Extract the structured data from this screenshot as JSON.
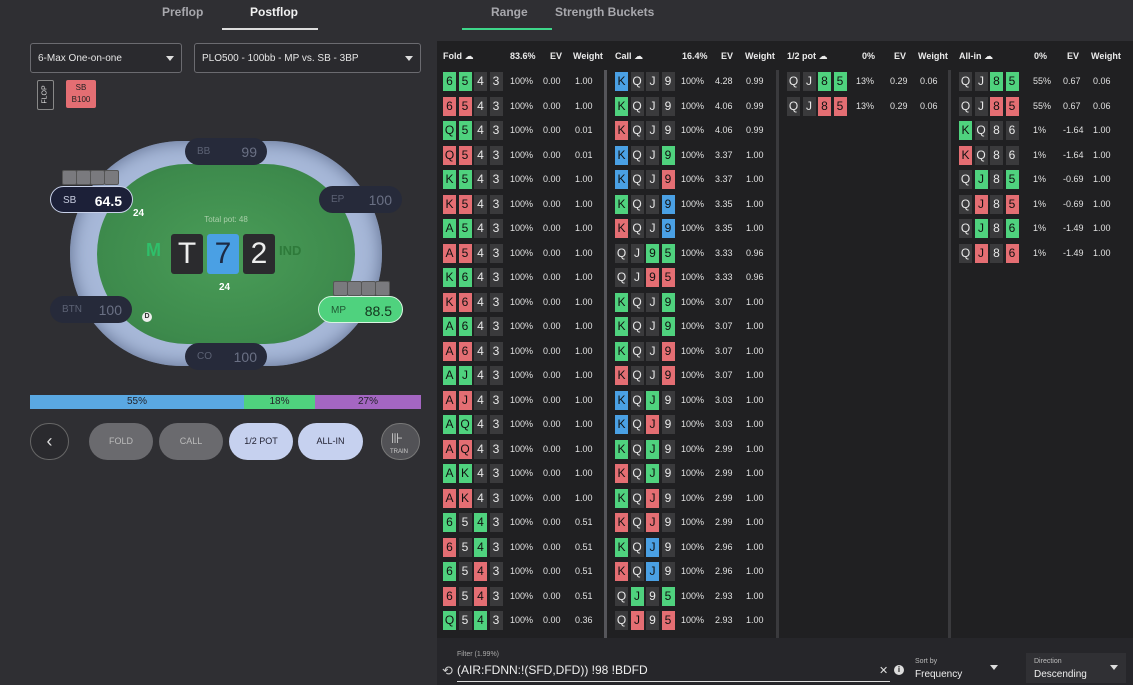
{
  "tabs": {
    "preflop": "Preflop",
    "postflop": "Postflop",
    "range": "Range",
    "buckets": "Strength Buckets"
  },
  "selects": {
    "game": "6-Max One-on-one",
    "spot": "PLO500 - 100bb - MP vs. SB - 3BP"
  },
  "chips": {
    "flop": "FLOP",
    "sb_line1": "SB",
    "sb_line2": "B100"
  },
  "table": {
    "total_pot": "Total pot: 48",
    "board": [
      "T",
      "7",
      "2"
    ],
    "brand": "IND",
    "seats": {
      "bb": {
        "name": "BB",
        "stack": "99"
      },
      "sb": {
        "name": "SB",
        "stack": "64.5",
        "bet": "24"
      },
      "ep": {
        "name": "EP",
        "stack": "100"
      },
      "btn": {
        "name": "BTN",
        "stack": "100"
      },
      "mp": {
        "name": "MP",
        "stack": "88.5",
        "bet": "24"
      },
      "co": {
        "name": "CO",
        "stack": "100"
      }
    },
    "dealer": "D"
  },
  "freq_bar": [
    {
      "label": "55%",
      "value": 55,
      "color": "#5aa8e2"
    },
    {
      "label": "18%",
      "value": 18,
      "color": "#4fd27e"
    },
    {
      "label": "27%",
      "value": 27,
      "color": "#a466c2"
    }
  ],
  "buttons": {
    "back": "‹",
    "fold": "FOLD",
    "call": "CALL",
    "half": "1/2 POT",
    "allin": "ALL-IN",
    "train": "TRAIN"
  },
  "headers": {
    "fold": {
      "title": "Fold",
      "pct": "83.6%",
      "ev": "EV",
      "w": "Weight"
    },
    "call": {
      "title": "Call",
      "pct": "16.4%",
      "ev": "EV",
      "w": "Weight"
    },
    "half": {
      "title": "1/2 pot",
      "pct": "0%",
      "ev": "EV",
      "w": "Weight"
    },
    "allin": {
      "title": "All-in",
      "pct": "0%",
      "ev": "EV",
      "w": "Weight"
    }
  },
  "fold_rows": [
    {
      "c": [
        [
          "6",
          "g"
        ],
        [
          "5",
          "g"
        ],
        [
          "4",
          "d"
        ],
        [
          "3",
          "d"
        ]
      ],
      "p": "100%",
      "e": "0.00",
      "w": "1.00"
    },
    {
      "c": [
        [
          "6",
          "r"
        ],
        [
          "5",
          "r"
        ],
        [
          "4",
          "d"
        ],
        [
          "3",
          "d"
        ]
      ],
      "p": "100%",
      "e": "0.00",
      "w": "1.00"
    },
    {
      "c": [
        [
          "Q",
          "g"
        ],
        [
          "5",
          "g"
        ],
        [
          "4",
          "d"
        ],
        [
          "3",
          "d"
        ]
      ],
      "p": "100%",
      "e": "0.00",
      "w": "0.01"
    },
    {
      "c": [
        [
          "Q",
          "r"
        ],
        [
          "5",
          "r"
        ],
        [
          "4",
          "d"
        ],
        [
          "3",
          "d"
        ]
      ],
      "p": "100%",
      "e": "0.00",
      "w": "0.01"
    },
    {
      "c": [
        [
          "K",
          "g"
        ],
        [
          "5",
          "g"
        ],
        [
          "4",
          "d"
        ],
        [
          "3",
          "d"
        ]
      ],
      "p": "100%",
      "e": "0.00",
      "w": "1.00"
    },
    {
      "c": [
        [
          "K",
          "r"
        ],
        [
          "5",
          "r"
        ],
        [
          "4",
          "d"
        ],
        [
          "3",
          "d"
        ]
      ],
      "p": "100%",
      "e": "0.00",
      "w": "1.00"
    },
    {
      "c": [
        [
          "A",
          "g"
        ],
        [
          "5",
          "g"
        ],
        [
          "4",
          "d"
        ],
        [
          "3",
          "d"
        ]
      ],
      "p": "100%",
      "e": "0.00",
      "w": "1.00"
    },
    {
      "c": [
        [
          "A",
          "r"
        ],
        [
          "5",
          "r"
        ],
        [
          "4",
          "d"
        ],
        [
          "3",
          "d"
        ]
      ],
      "p": "100%",
      "e": "0.00",
      "w": "1.00"
    },
    {
      "c": [
        [
          "K",
          "g"
        ],
        [
          "6",
          "g"
        ],
        [
          "4",
          "d"
        ],
        [
          "3",
          "d"
        ]
      ],
      "p": "100%",
      "e": "0.00",
      "w": "1.00"
    },
    {
      "c": [
        [
          "K",
          "r"
        ],
        [
          "6",
          "r"
        ],
        [
          "4",
          "d"
        ],
        [
          "3",
          "d"
        ]
      ],
      "p": "100%",
      "e": "0.00",
      "w": "1.00"
    },
    {
      "c": [
        [
          "A",
          "g"
        ],
        [
          "6",
          "g"
        ],
        [
          "4",
          "d"
        ],
        [
          "3",
          "d"
        ]
      ],
      "p": "100%",
      "e": "0.00",
      "w": "1.00"
    },
    {
      "c": [
        [
          "A",
          "r"
        ],
        [
          "6",
          "r"
        ],
        [
          "4",
          "d"
        ],
        [
          "3",
          "d"
        ]
      ],
      "p": "100%",
      "e": "0.00",
      "w": "1.00"
    },
    {
      "c": [
        [
          "A",
          "g"
        ],
        [
          "J",
          "g"
        ],
        [
          "4",
          "d"
        ],
        [
          "3",
          "d"
        ]
      ],
      "p": "100%",
      "e": "0.00",
      "w": "1.00"
    },
    {
      "c": [
        [
          "A",
          "r"
        ],
        [
          "J",
          "r"
        ],
        [
          "4",
          "d"
        ],
        [
          "3",
          "d"
        ]
      ],
      "p": "100%",
      "e": "0.00",
      "w": "1.00"
    },
    {
      "c": [
        [
          "A",
          "g"
        ],
        [
          "Q",
          "g"
        ],
        [
          "4",
          "d"
        ],
        [
          "3",
          "d"
        ]
      ],
      "p": "100%",
      "e": "0.00",
      "w": "1.00"
    },
    {
      "c": [
        [
          "A",
          "r"
        ],
        [
          "Q",
          "r"
        ],
        [
          "4",
          "d"
        ],
        [
          "3",
          "d"
        ]
      ],
      "p": "100%",
      "e": "0.00",
      "w": "1.00"
    },
    {
      "c": [
        [
          "A",
          "g"
        ],
        [
          "K",
          "g"
        ],
        [
          "4",
          "d"
        ],
        [
          "3",
          "d"
        ]
      ],
      "p": "100%",
      "e": "0.00",
      "w": "1.00"
    },
    {
      "c": [
        [
          "A",
          "r"
        ],
        [
          "K",
          "r"
        ],
        [
          "4",
          "d"
        ],
        [
          "3",
          "d"
        ]
      ],
      "p": "100%",
      "e": "0.00",
      "w": "1.00"
    },
    {
      "c": [
        [
          "6",
          "g"
        ],
        [
          "5",
          "d"
        ],
        [
          "4",
          "g"
        ],
        [
          "3",
          "d"
        ]
      ],
      "p": "100%",
      "e": "0.00",
      "w": "0.51"
    },
    {
      "c": [
        [
          "6",
          "r"
        ],
        [
          "5",
          "d"
        ],
        [
          "4",
          "g"
        ],
        [
          "3",
          "d"
        ]
      ],
      "p": "100%",
      "e": "0.00",
      "w": "0.51"
    },
    {
      "c": [
        [
          "6",
          "g"
        ],
        [
          "5",
          "d"
        ],
        [
          "4",
          "r"
        ],
        [
          "3",
          "d"
        ]
      ],
      "p": "100%",
      "e": "0.00",
      "w": "0.51"
    },
    {
      "c": [
        [
          "6",
          "r"
        ],
        [
          "5",
          "d"
        ],
        [
          "4",
          "r"
        ],
        [
          "3",
          "d"
        ]
      ],
      "p": "100%",
      "e": "0.00",
      "w": "0.51"
    },
    {
      "c": [
        [
          "Q",
          "g"
        ],
        [
          "5",
          "d"
        ],
        [
          "4",
          "g"
        ],
        [
          "3",
          "d"
        ]
      ],
      "p": "100%",
      "e": "0.00",
      "w": "0.36"
    }
  ],
  "call_rows": [
    {
      "c": [
        [
          "K",
          "b"
        ],
        [
          "Q",
          "d"
        ],
        [
          "J",
          "d"
        ],
        [
          "9",
          "d"
        ]
      ],
      "p": "100%",
      "e": "4.28",
      "w": "0.99"
    },
    {
      "c": [
        [
          "K",
          "g"
        ],
        [
          "Q",
          "d"
        ],
        [
          "J",
          "d"
        ],
        [
          "9",
          "d"
        ]
      ],
      "p": "100%",
      "e": "4.06",
      "w": "0.99"
    },
    {
      "c": [
        [
          "K",
          "r"
        ],
        [
          "Q",
          "d"
        ],
        [
          "J",
          "d"
        ],
        [
          "9",
          "d"
        ]
      ],
      "p": "100%",
      "e": "4.06",
      "w": "0.99"
    },
    {
      "c": [
        [
          "K",
          "b"
        ],
        [
          "Q",
          "d"
        ],
        [
          "J",
          "d"
        ],
        [
          "9",
          "g"
        ]
      ],
      "p": "100%",
      "e": "3.37",
      "w": "1.00"
    },
    {
      "c": [
        [
          "K",
          "b"
        ],
        [
          "Q",
          "d"
        ],
        [
          "J",
          "d"
        ],
        [
          "9",
          "r"
        ]
      ],
      "p": "100%",
      "e": "3.37",
      "w": "1.00"
    },
    {
      "c": [
        [
          "K",
          "g"
        ],
        [
          "Q",
          "d"
        ],
        [
          "J",
          "d"
        ],
        [
          "9",
          "b"
        ]
      ],
      "p": "100%",
      "e": "3.35",
      "w": "1.00"
    },
    {
      "c": [
        [
          "K",
          "r"
        ],
        [
          "Q",
          "d"
        ],
        [
          "J",
          "d"
        ],
        [
          "9",
          "b"
        ]
      ],
      "p": "100%",
      "e": "3.35",
      "w": "1.00"
    },
    {
      "c": [
        [
          "Q",
          "d"
        ],
        [
          "J",
          "d"
        ],
        [
          "9",
          "g"
        ],
        [
          "5",
          "g"
        ]
      ],
      "p": "100%",
      "e": "3.33",
      "w": "0.96"
    },
    {
      "c": [
        [
          "Q",
          "d"
        ],
        [
          "J",
          "d"
        ],
        [
          "9",
          "r"
        ],
        [
          "5",
          "r"
        ]
      ],
      "p": "100%",
      "e": "3.33",
      "w": "0.96"
    },
    {
      "c": [
        [
          "K",
          "g"
        ],
        [
          "Q",
          "d"
        ],
        [
          "J",
          "d"
        ],
        [
          "9",
          "g"
        ]
      ],
      "p": "100%",
      "e": "3.07",
      "w": "1.00"
    },
    {
      "c": [
        [
          "K",
          "g"
        ],
        [
          "Q",
          "d"
        ],
        [
          "J",
          "d"
        ],
        [
          "9",
          "g"
        ]
      ],
      "p": "100%",
      "e": "3.07",
      "w": "1.00"
    },
    {
      "c": [
        [
          "K",
          "g"
        ],
        [
          "Q",
          "d"
        ],
        [
          "J",
          "d"
        ],
        [
          "9",
          "r"
        ]
      ],
      "p": "100%",
      "e": "3.07",
      "w": "1.00"
    },
    {
      "c": [
        [
          "K",
          "r"
        ],
        [
          "Q",
          "d"
        ],
        [
          "J",
          "d"
        ],
        [
          "9",
          "r"
        ]
      ],
      "p": "100%",
      "e": "3.07",
      "w": "1.00"
    },
    {
      "c": [
        [
          "K",
          "b"
        ],
        [
          "Q",
          "d"
        ],
        [
          "J",
          "g"
        ],
        [
          "9",
          "d"
        ]
      ],
      "p": "100%",
      "e": "3.03",
      "w": "1.00"
    },
    {
      "c": [
        [
          "K",
          "b"
        ],
        [
          "Q",
          "d"
        ],
        [
          "J",
          "r"
        ],
        [
          "9",
          "d"
        ]
      ],
      "p": "100%",
      "e": "3.03",
      "w": "1.00"
    },
    {
      "c": [
        [
          "K",
          "g"
        ],
        [
          "Q",
          "d"
        ],
        [
          "J",
          "g"
        ],
        [
          "9",
          "d"
        ]
      ],
      "p": "100%",
      "e": "2.99",
      "w": "1.00"
    },
    {
      "c": [
        [
          "K",
          "r"
        ],
        [
          "Q",
          "d"
        ],
        [
          "J",
          "g"
        ],
        [
          "9",
          "d"
        ]
      ],
      "p": "100%",
      "e": "2.99",
      "w": "1.00"
    },
    {
      "c": [
        [
          "K",
          "g"
        ],
        [
          "Q",
          "d"
        ],
        [
          "J",
          "r"
        ],
        [
          "9",
          "d"
        ]
      ],
      "p": "100%",
      "e": "2.99",
      "w": "1.00"
    },
    {
      "c": [
        [
          "K",
          "r"
        ],
        [
          "Q",
          "d"
        ],
        [
          "J",
          "r"
        ],
        [
          "9",
          "d"
        ]
      ],
      "p": "100%",
      "e": "2.99",
      "w": "1.00"
    },
    {
      "c": [
        [
          "K",
          "g"
        ],
        [
          "Q",
          "d"
        ],
        [
          "J",
          "b"
        ],
        [
          "9",
          "d"
        ]
      ],
      "p": "100%",
      "e": "2.96",
      "w": "1.00"
    },
    {
      "c": [
        [
          "K",
          "r"
        ],
        [
          "Q",
          "d"
        ],
        [
          "J",
          "b"
        ],
        [
          "9",
          "d"
        ]
      ],
      "p": "100%",
      "e": "2.96",
      "w": "1.00"
    },
    {
      "c": [
        [
          "Q",
          "d"
        ],
        [
          "J",
          "g"
        ],
        [
          "9",
          "d"
        ],
        [
          "5",
          "g"
        ]
      ],
      "p": "100%",
      "e": "2.93",
      "w": "1.00"
    },
    {
      "c": [
        [
          "Q",
          "d"
        ],
        [
          "J",
          "r"
        ],
        [
          "9",
          "d"
        ],
        [
          "5",
          "r"
        ]
      ],
      "p": "100%",
      "e": "2.93",
      "w": "1.00"
    }
  ],
  "half_rows": [
    {
      "c": [
        [
          "Q",
          "d"
        ],
        [
          "J",
          "d"
        ],
        [
          "8",
          "g"
        ],
        [
          "5",
          "g"
        ]
      ],
      "p": "13%",
      "e": "0.29",
      "w": "0.06"
    },
    {
      "c": [
        [
          "Q",
          "d"
        ],
        [
          "J",
          "d"
        ],
        [
          "8",
          "r"
        ],
        [
          "5",
          "r"
        ]
      ],
      "p": "13%",
      "e": "0.29",
      "w": "0.06"
    }
  ],
  "allin_rows": [
    {
      "c": [
        [
          "Q",
          "d"
        ],
        [
          "J",
          "d"
        ],
        [
          "8",
          "g"
        ],
        [
          "5",
          "g"
        ]
      ],
      "p": "55%",
      "e": "0.67",
      "w": "0.06"
    },
    {
      "c": [
        [
          "Q",
          "d"
        ],
        [
          "J",
          "d"
        ],
        [
          "8",
          "r"
        ],
        [
          "5",
          "r"
        ]
      ],
      "p": "55%",
      "e": "0.67",
      "w": "0.06"
    },
    {
      "c": [
        [
          "K",
          "g"
        ],
        [
          "Q",
          "d"
        ],
        [
          "8",
          "d"
        ],
        [
          "6",
          "d"
        ]
      ],
      "p": "1%",
      "e": "-1.64",
      "w": "1.00"
    },
    {
      "c": [
        [
          "K",
          "r"
        ],
        [
          "Q",
          "d"
        ],
        [
          "8",
          "d"
        ],
        [
          "6",
          "d"
        ]
      ],
      "p": "1%",
      "e": "-1.64",
      "w": "1.00"
    },
    {
      "c": [
        [
          "Q",
          "d"
        ],
        [
          "J",
          "g"
        ],
        [
          "8",
          "d"
        ],
        [
          "5",
          "g"
        ]
      ],
      "p": "1%",
      "e": "-0.69",
      "w": "1.00"
    },
    {
      "c": [
        [
          "Q",
          "d"
        ],
        [
          "J",
          "r"
        ],
        [
          "8",
          "d"
        ],
        [
          "5",
          "r"
        ]
      ],
      "p": "1%",
      "e": "-0.69",
      "w": "1.00"
    },
    {
      "c": [
        [
          "Q",
          "d"
        ],
        [
          "J",
          "g"
        ],
        [
          "8",
          "d"
        ],
        [
          "6",
          "g"
        ]
      ],
      "p": "1%",
      "e": "-1.49",
      "w": "1.00"
    },
    {
      "c": [
        [
          "Q",
          "d"
        ],
        [
          "J",
          "r"
        ],
        [
          "8",
          "d"
        ],
        [
          "6",
          "r"
        ]
      ],
      "p": "1%",
      "e": "-1.49",
      "w": "1.00"
    }
  ],
  "filter": {
    "label": "Filter (1.99%)",
    "value": "(AIR:FDNN:!(SFD,DFD))  !98 !BDFD",
    "sort_label": "Sort by",
    "sort_value": "Frequency",
    "dir_label": "Direction",
    "dir_value": "Descending"
  },
  "colors": {
    "accent_green": "#3ed68a",
    "felt": "#3d8a4c",
    "rail": "#a7b8d8"
  }
}
